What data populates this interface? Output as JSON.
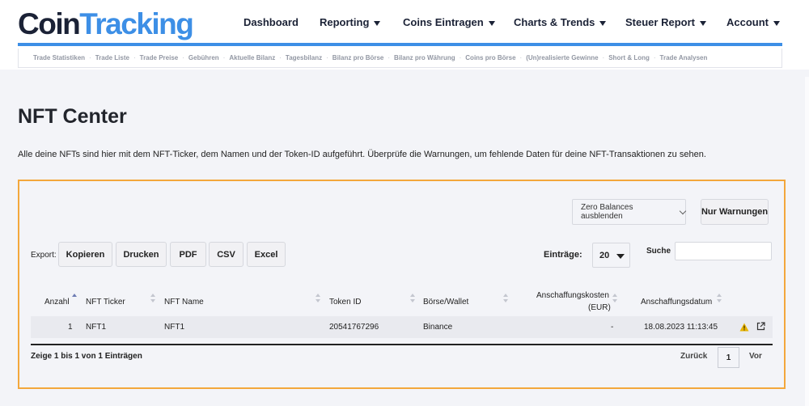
{
  "logo": {
    "part1": "Coin",
    "part2": "Tracking"
  },
  "nav": [
    {
      "label": "Dashboard",
      "dropdown": false
    },
    {
      "label": "Reporting",
      "dropdown": true
    },
    {
      "label": "Coins Eintragen",
      "dropdown": true
    },
    {
      "label": "Charts & Trends",
      "dropdown": true
    },
    {
      "label": "Steuer Report",
      "dropdown": true
    },
    {
      "label": "Account",
      "dropdown": true
    }
  ],
  "subnav": [
    "Trade Statistiken",
    "Trade Liste",
    "Trade Preise",
    "Gebühren",
    "Aktuelle Bilanz",
    "Tagesbilanz",
    "Bilanz pro Börse",
    "Bilanz pro Währung",
    "Coins pro Börse",
    "(Un)realisierte Gewinne",
    "Short & Long",
    "Trade Analysen"
  ],
  "page": {
    "title": "NFT Center",
    "description": "Alle deine NFTs sind hier mit dem NFT-Ticker, dem Namen und der Token-ID aufgeführt. Überprüfe die Warnungen, um fehlende Daten für deine NFT-Transaktionen zu sehen."
  },
  "controls": {
    "zero_balances": "Zero Balances ausblenden",
    "only_warnings": "Nur Warnungen",
    "export_label": "Export:",
    "export_buttons": [
      "Kopieren",
      "Drucken",
      "PDF",
      "CSV",
      "Excel"
    ],
    "entries_label": "Einträge:",
    "entries_value": "20",
    "search_label": "Suche",
    "search_value": ""
  },
  "table": {
    "columns": [
      "Anzahl",
      "NFT Ticker",
      "NFT Name",
      "Token ID",
      "Börse/Wallet",
      "Anschaffungskosten",
      "(EUR)",
      "Anschaffungsdatum"
    ],
    "rows": [
      {
        "amount": "1",
        "ticker": "NFT1",
        "name": "NFT1",
        "token_id": "20541767296",
        "exchange": "Binance",
        "cost": "-",
        "date": "18.08.2023 11:13:45",
        "warning": true
      }
    ]
  },
  "footer": {
    "info": "Zeige 1 bis 1 von 1 Einträgen",
    "prev": "Zurück",
    "current_page": "1",
    "next": "Vor"
  },
  "colors": {
    "brand_dark": "#1b2236",
    "brand_blue": "#3d8fe6",
    "panel_border": "#f3a73c",
    "warning": "#e8b400"
  },
  "icons": {
    "warning": "warning-icon",
    "external_link": "external-link-icon"
  }
}
